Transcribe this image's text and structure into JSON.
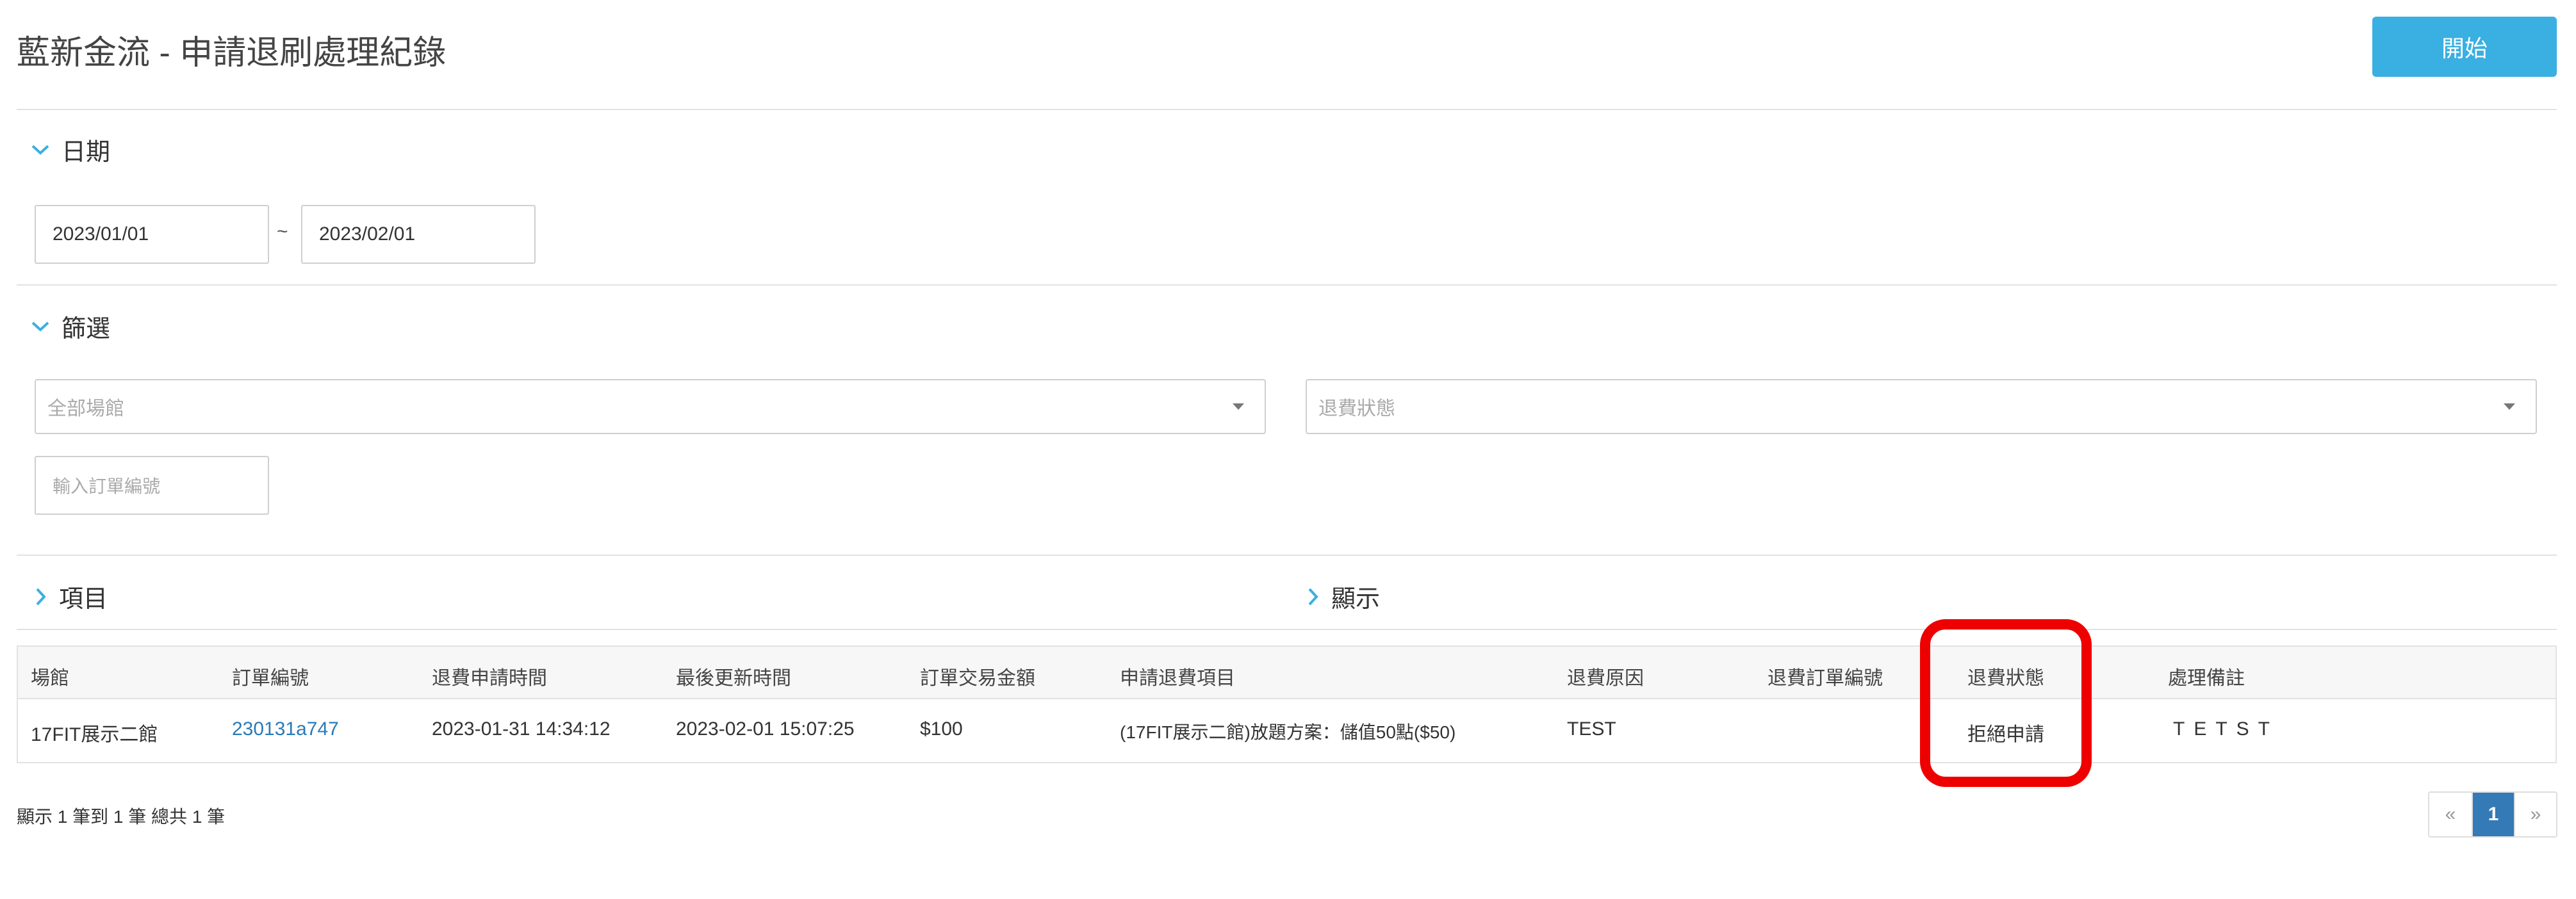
{
  "header": {
    "title": "藍新金流 - 申請退刷處理紀錄",
    "start_button": "開始"
  },
  "date_section": {
    "label": "日期",
    "start_date": "2023/01/01",
    "separator": "~",
    "end_date": "2023/02/01"
  },
  "filter_section": {
    "label": "篩選",
    "venue_select": "全部場館",
    "status_select": "退費狀態",
    "order_input_placeholder": "輸入訂單編號"
  },
  "items_section": {
    "label": "項目"
  },
  "display_section": {
    "label": "顯示"
  },
  "table": {
    "columns": [
      "場館",
      "訂單編號",
      "退費申請時間",
      "最後更新時間",
      "訂單交易金額",
      "申請退費項目",
      "退費原因",
      "退費訂單編號",
      "退費狀態",
      "處理備註"
    ],
    "rows": [
      {
        "venue": "17FIT展示二館",
        "order_no": "230131a747",
        "apply_time": "2023-01-31 14:34:12",
        "updated_time": "2023-02-01 15:07:25",
        "amount": "$100",
        "refund_item": "(17FIT展示二館)放題方案：儲值50點($50)",
        "reason": "TEST",
        "refund_order_no": "",
        "status": "拒絕申請",
        "note": "TETST"
      }
    ]
  },
  "footer": {
    "summary": "顯示 1 筆到 1 筆 總共 1 筆"
  },
  "pagination": {
    "prev": "«",
    "current": "1",
    "next": "»"
  },
  "colors": {
    "accent": "#3aafe1",
    "link": "#2a7ab8",
    "highlight": "#ee0000",
    "active_page": "#337ab7"
  }
}
